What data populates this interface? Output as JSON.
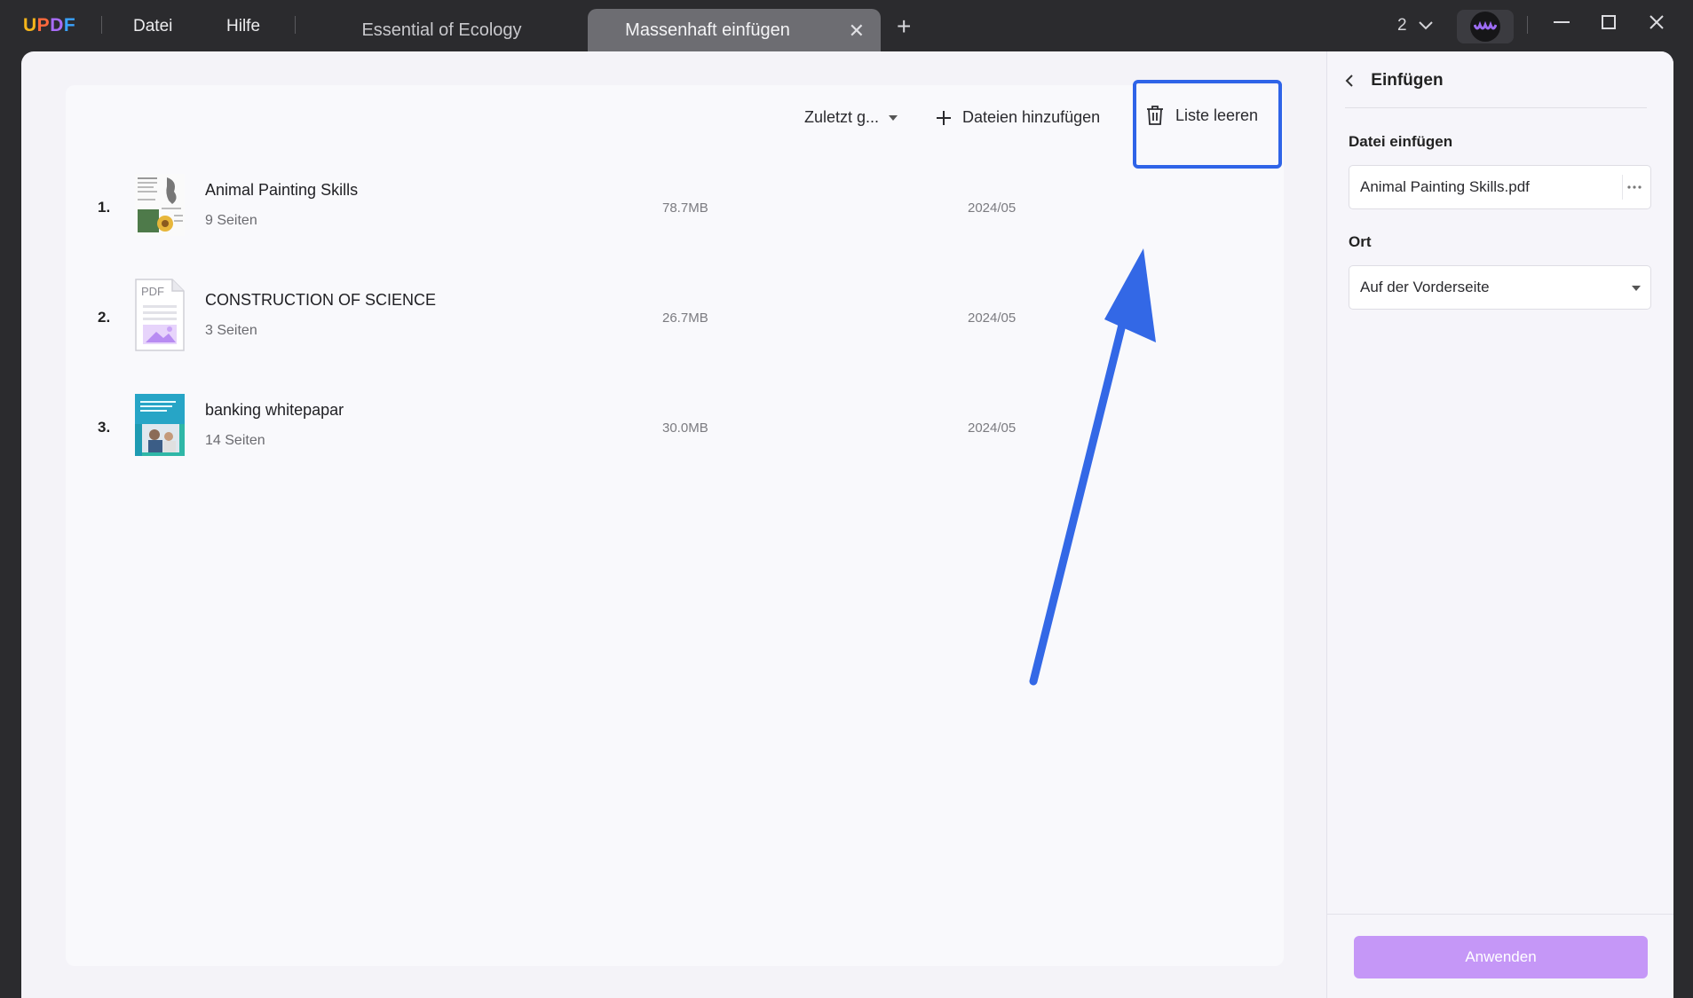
{
  "app": {
    "logo": [
      "U",
      "P",
      "D",
      "F"
    ],
    "menu": {
      "file": "Datei",
      "help": "Hilfe"
    }
  },
  "tabs": [
    {
      "label": "Essential of Ecology",
      "active": false
    },
    {
      "label": "Massenhaft einfügen",
      "active": true
    }
  ],
  "titlebar": {
    "page_count": "2",
    "close_tab": "✕",
    "add_tab": "+"
  },
  "toolbar": {
    "sort_label": "Zuletzt g...",
    "add_files_label": "Dateien hinzufügen",
    "clear_list_label": "Liste leeren"
  },
  "files": [
    {
      "index": "1.",
      "name": "Animal Painting Skills",
      "pages": "9 Seiten",
      "size": "78.7MB",
      "date": "2024/05",
      "thumb": "animal"
    },
    {
      "index": "2.",
      "name": "CONSTRUCTION OF SCIENCE",
      "pages": "3 Seiten",
      "size": "26.7MB",
      "date": "2024/05",
      "thumb": "pdf"
    },
    {
      "index": "3.",
      "name": "banking whitepapar",
      "pages": "14 Seiten",
      "size": "30.0MB",
      "date": "2024/05",
      "thumb": "banking"
    }
  ],
  "insert_panel": {
    "title": "Einfügen",
    "file_label": "Datei einfügen",
    "file_value": "Animal Painting Skills.pdf",
    "location_label": "Ort",
    "location_value": "Auf der Vorderseite",
    "apply_label": "Anwenden"
  },
  "colors": {
    "accent_box": "#2f64e8",
    "arrow": "#3368e6",
    "apply_button": "#c597f7"
  },
  "icons": {
    "back": "chevron-left-icon",
    "more": "more-dots-icon",
    "dropdown": "caret-down-icon",
    "trash": "trash-icon",
    "add": "plus-icon"
  }
}
